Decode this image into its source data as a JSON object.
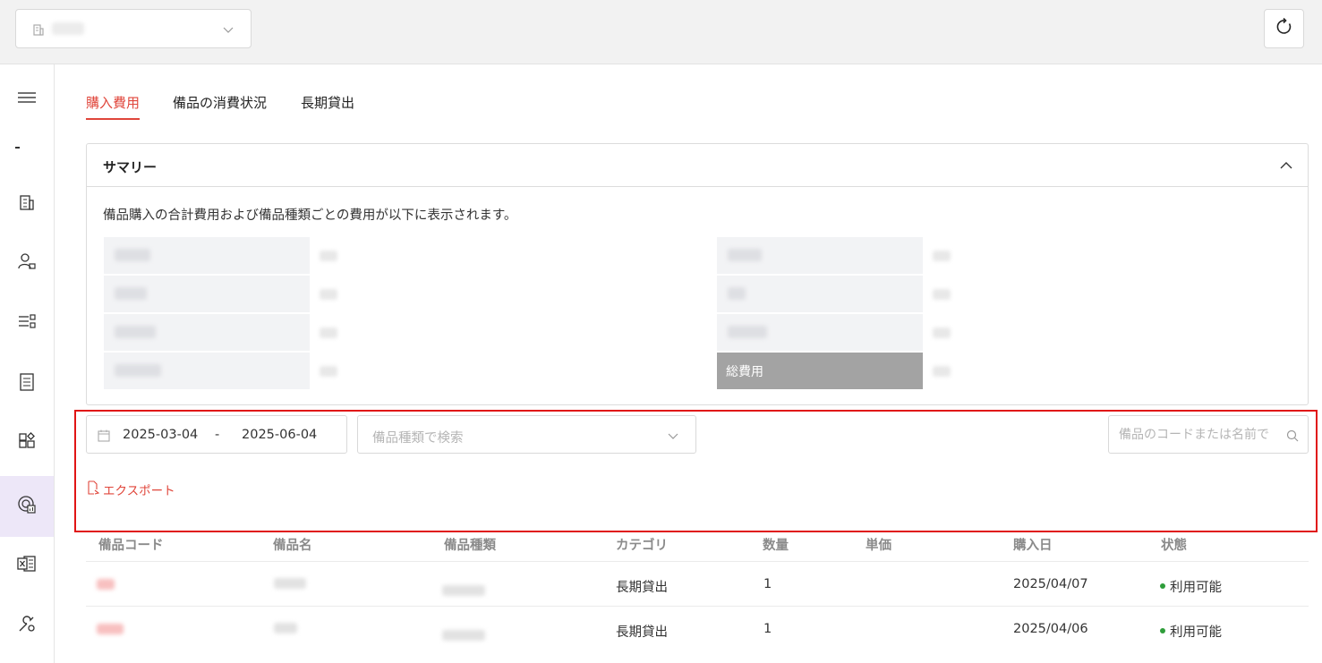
{
  "topbar": {
    "org_icon": "building-icon",
    "refresh_icon": "refresh-icon"
  },
  "sidebar": {
    "items": [
      {
        "icon": "menu-icon"
      },
      {
        "icon": "building-icon"
      },
      {
        "icon": "user-lock-icon"
      },
      {
        "icon": "list-settings-icon"
      },
      {
        "icon": "document-list-icon"
      },
      {
        "icon": "widgets-icon"
      },
      {
        "icon": "chart-report-icon",
        "active": true
      },
      {
        "icon": "excel-icon"
      },
      {
        "icon": "tools-icon"
      }
    ]
  },
  "tabs": [
    {
      "label": "購入費用",
      "active": true
    },
    {
      "label": "備品の消費状況",
      "active": false
    },
    {
      "label": "長期貸出",
      "active": false
    }
  ],
  "summary": {
    "title": "サマリー",
    "description": "備品購入の合計費用および備品種類ごとの費用が以下に表示されます。",
    "total_label": "総費用"
  },
  "filters": {
    "date_from": "2025-03-04",
    "date_separator": "-",
    "date_to": "2025-06-04",
    "type_placeholder": "備品種類で検索",
    "search_placeholder": "備品のコードまたは名前で"
  },
  "export_label": "エクスポート",
  "table": {
    "headers": [
      "備品コード",
      "備品名",
      "備品種類",
      "カテゴリ",
      "数量",
      "単価",
      "購入日",
      "状態"
    ],
    "rows": [
      {
        "category": "長期貸出",
        "quantity": "1",
        "purchase_date": "2025/04/07",
        "status": "利用可能"
      },
      {
        "category": "長期貸出",
        "quantity": "1",
        "purchase_date": "2025/04/06",
        "status": "利用可能"
      }
    ]
  },
  "colors": {
    "accent": "#e0463b",
    "highlight_border": "#e01414",
    "status_available": "#2e9d3a",
    "active_nav_bg": "#ede7f8",
    "total_cell_bg": "#a3a3a3"
  }
}
